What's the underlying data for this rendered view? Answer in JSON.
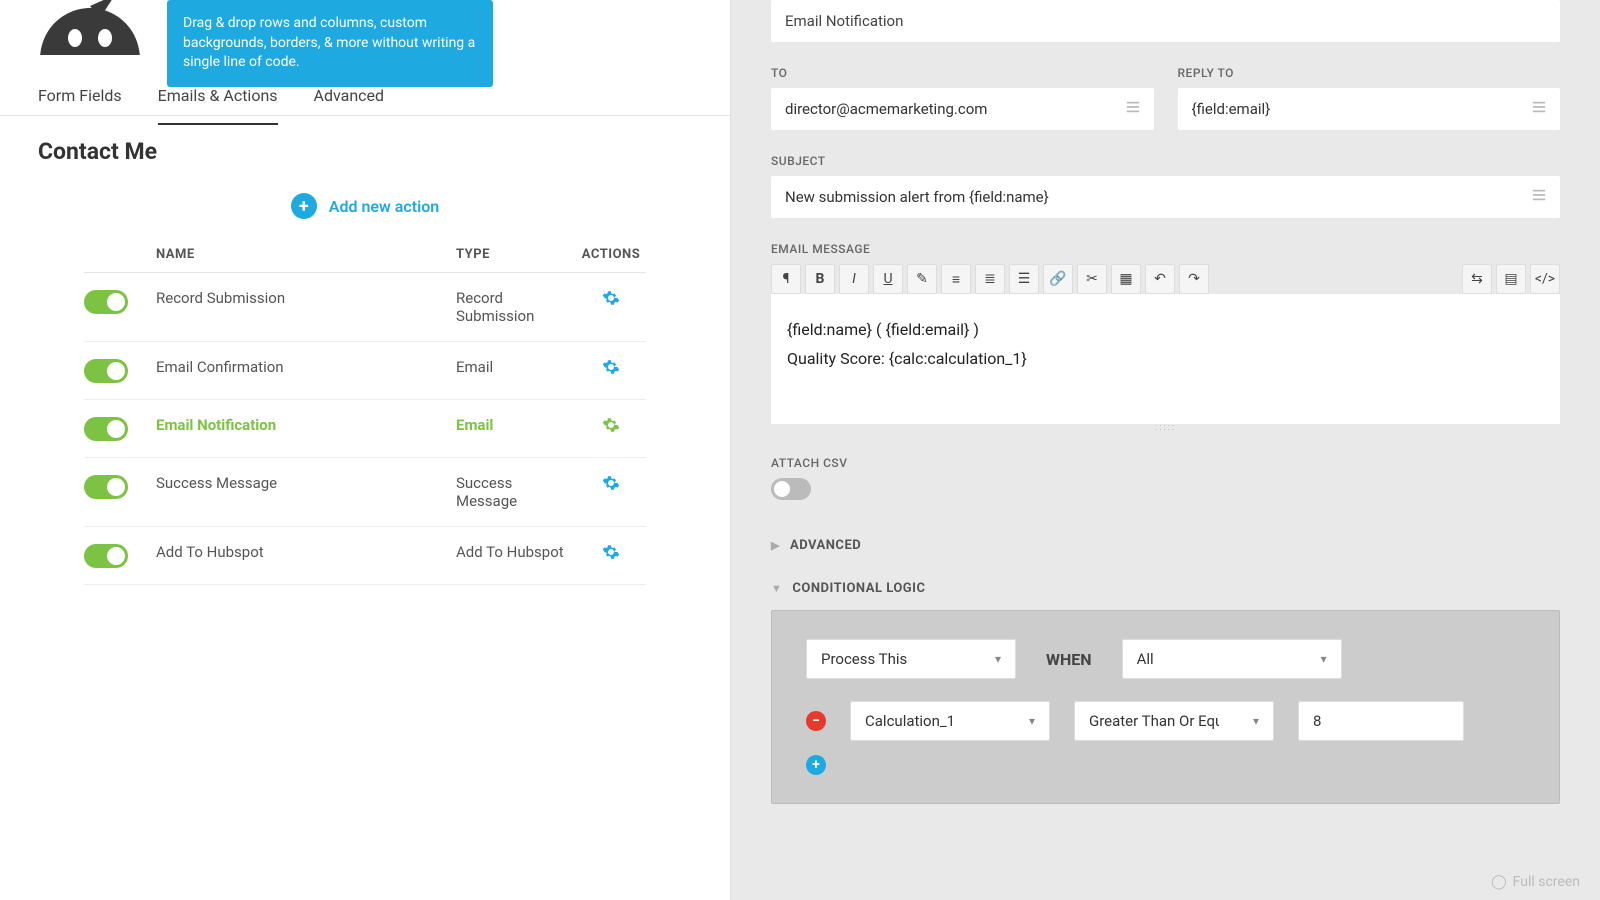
{
  "tooltip": "Drag & drop rows and columns, custom backgrounds, borders, & more without writing a single line of code.",
  "tabs": {
    "form_fields": "Form Fields",
    "emails_actions": "Emails & Actions",
    "advanced": "Advanced"
  },
  "form_title": "Contact Me",
  "add_action_label": "Add new action",
  "table_headers": {
    "name": "NAME",
    "type": "TYPE",
    "actions": "ACTIONS"
  },
  "actions": [
    {
      "name": "Record Submission",
      "type": "Record Submission",
      "active": false
    },
    {
      "name": "Email Confirmation",
      "type": "Email",
      "active": false
    },
    {
      "name": "Email Notification",
      "type": "Email",
      "active": true
    },
    {
      "name": "Success Message",
      "type": "Success Message",
      "active": false
    },
    {
      "name": "Add To Hubspot",
      "type": "Add To Hubspot",
      "active": false
    }
  ],
  "right": {
    "action_name": "Email Notification",
    "to_label": "TO",
    "to_value": "director@acmemarketing.com",
    "reply_to_label": "REPLY TO",
    "reply_to_value": "{field:email}",
    "subject_label": "SUBJECT",
    "subject_value": "New submission alert from {field:name}",
    "message_label": "EMAIL MESSAGE",
    "message_line1": "{field:name} ( {field:email} )",
    "message_line2": "Quality Score: {calc:calculation_1}",
    "attach_csv_label": "ATTACH CSV",
    "advanced_label": "ADVANCED",
    "conditional_label": "CONDITIONAL LOGIC",
    "cond": {
      "process": "Process This",
      "when": "WHEN",
      "match": "All",
      "field": "Calculation_1",
      "op": "Greater Than Or Equal",
      "value": "8"
    }
  },
  "fullscreen": "Full screen"
}
